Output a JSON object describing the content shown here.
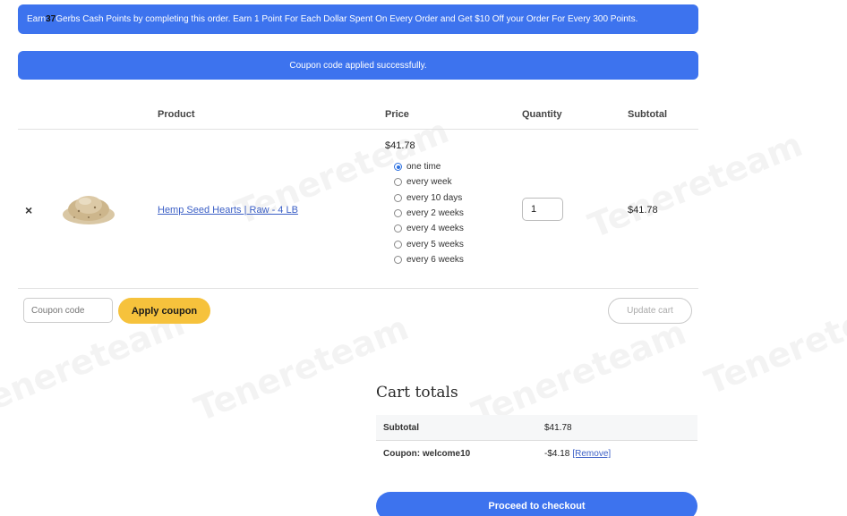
{
  "notices": {
    "points_prefix": "Earn ",
    "points_value": "37",
    "points_suffix": " Gerbs Cash Points by completing this order. Earn 1 Point For Each Dollar Spent On Every Order and Get $10 Off your Order For Every 300 Points.",
    "coupon_applied": "Coupon code applied successfully."
  },
  "cart": {
    "headers": {
      "product": "Product",
      "price": "Price",
      "quantity": "Quantity",
      "subtotal": "Subtotal"
    },
    "item": {
      "remove": "×",
      "image_icon": "hemp-seed-pile",
      "name": "Hemp Seed Hearts | Raw - 4 LB",
      "price": "$41.78",
      "schedule_options": [
        "one time",
        "every week",
        "every 10 days",
        "every 2 weeks",
        "every 4 weeks",
        "every 5 weeks",
        "every 6 weeks"
      ],
      "schedule_selected": "one time",
      "quantity": "1",
      "subtotal": "$41.78"
    }
  },
  "actions": {
    "coupon_placeholder": "Coupon code",
    "apply_coupon": "Apply coupon",
    "update_cart": "Update cart"
  },
  "totals": {
    "title": "Cart totals",
    "subtotal_label": "Subtotal",
    "subtotal_value": "$41.78",
    "coupon_label": "Coupon: welcome10",
    "coupon_value": "-$4.18",
    "coupon_remove": "[Remove]",
    "checkout": "Proceed to checkout"
  },
  "watermark": "Tenereteam",
  "colors": {
    "accent_blue": "#3d73ee",
    "coupon_yellow": "#f6c23c",
    "link_blue": "#3b5fc6"
  }
}
